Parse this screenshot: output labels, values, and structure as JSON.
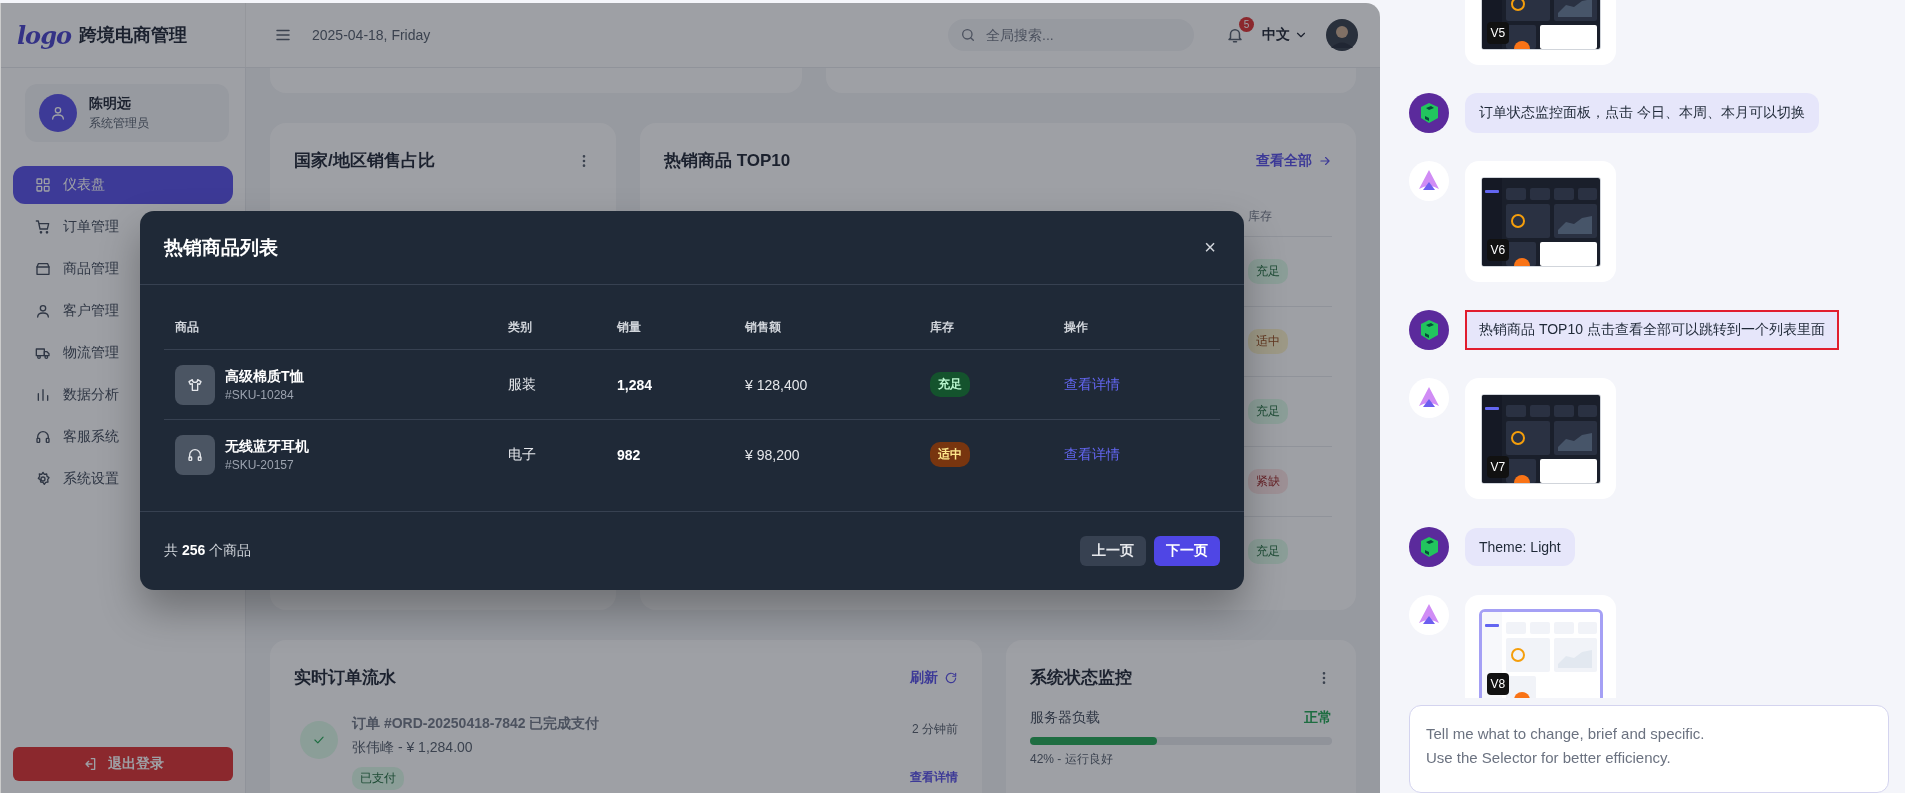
{
  "app": {
    "logo": "logo",
    "title": "跨境电商管理",
    "date": "2025-04-18, Friday",
    "search": {
      "placeholder": "全局搜索..."
    },
    "notifications": "5",
    "language": "中文",
    "user": {
      "name": "陈明远",
      "role": "系统管理员"
    },
    "nav": [
      {
        "label": "仪表盘",
        "selected": true
      },
      {
        "label": "订单管理",
        "selected": false
      },
      {
        "label": "商品管理",
        "selected": false
      },
      {
        "label": "客户管理",
        "selected": false
      },
      {
        "label": "物流管理",
        "selected": false
      },
      {
        "label": "数据分析",
        "selected": false
      },
      {
        "label": "客服系统",
        "selected": false
      },
      {
        "label": "系统设置",
        "selected": false
      }
    ],
    "logout": "退出登录"
  },
  "region_card": {
    "title": "国家/地区销售占比"
  },
  "top_products_card": {
    "title": "热销商品 TOP10",
    "view_all": "查看全部",
    "column": "库存",
    "stock": [
      {
        "label": "充足",
        "kind": "ok"
      },
      {
        "label": "适中",
        "kind": "mid"
      },
      {
        "label": "充足",
        "kind": "ok"
      },
      {
        "label": "紧缺",
        "kind": "low"
      },
      {
        "label": "充足",
        "kind": "ok"
      }
    ]
  },
  "orders_card": {
    "title": "实时订单流水",
    "refresh": "刷新",
    "items": [
      {
        "title": "订单 #ORD-20250418-7842 已完成支付",
        "detail": "张伟峰 - ¥ 1,284.00",
        "status": "已支付",
        "time": "2 分钟前",
        "link": "查看详情"
      }
    ]
  },
  "system_card": {
    "title": "系统状态监控",
    "metrics": [
      {
        "name": "服务器负载",
        "status": "正常",
        "level": 0.42,
        "reading": "42% - 运行良好"
      }
    ]
  },
  "modal": {
    "title": "热销商品列表",
    "close": "×",
    "columns": [
      "商品",
      "类别",
      "销量",
      "销售额",
      "库存",
      "操作"
    ],
    "rows": [
      {
        "name": "高级棉质T恤",
        "sku": "#SKU-10284",
        "category": "服装",
        "sales": "1,284",
        "revenue": "¥ 128,400",
        "stock": "充足",
        "kind": "ok",
        "action": "查看详情"
      },
      {
        "name": "无线蓝牙耳机",
        "sku": "#SKU-20157",
        "category": "电子",
        "sales": "982",
        "revenue": "¥ 98,200",
        "stock": "适中",
        "kind": "mid",
        "action": "查看详情"
      }
    ],
    "total": "共 **256** 个商品",
    "prev": "上一页",
    "next": "下一页"
  },
  "chat": {
    "messages": [
      {
        "kind": "darkshot",
        "version": "V5",
        "selected": false
      },
      {
        "kind": "text",
        "text": "订单状态监控面板，点击 今日、本周、本月可以切换",
        "highlighted": false
      },
      {
        "kind": "darkshot",
        "version": "V6",
        "selected": false
      },
      {
        "kind": "text",
        "text": "热销商品 TOP10 点击查看全部可以跳转到一个列表里面",
        "highlighted": true
      },
      {
        "kind": "darkshot",
        "version": "V7",
        "selected": false
      },
      {
        "kind": "text",
        "text": "Theme: Light",
        "highlighted": false
      },
      {
        "kind": "lightshot",
        "version": "V8",
        "selected": true
      }
    ],
    "input": {
      "placeholder": "Tell me what to change, brief and specific.\nUse the Selector for better efficiency."
    }
  }
}
